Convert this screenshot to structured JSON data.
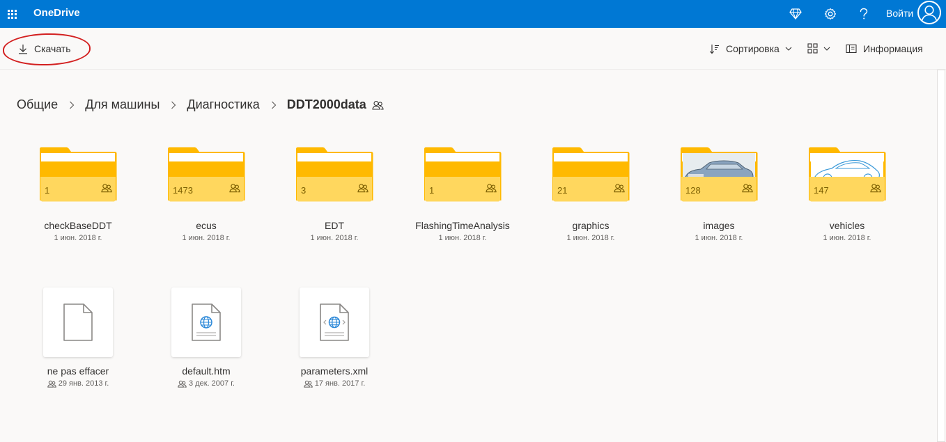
{
  "app": {
    "name": "OneDrive",
    "signin_label": "Войти"
  },
  "header_icons": [
    "premium-diamond-icon",
    "settings-gear-icon",
    "help-question-icon"
  ],
  "commands": {
    "download": "Скачать",
    "sort": "Сортировка",
    "info": "Информация"
  },
  "breadcrumb": {
    "items": [
      "Общие",
      "Для машины",
      "Диагностика"
    ],
    "current": "DDT2000data"
  },
  "folders": [
    {
      "name": "checkBaseDDT",
      "count": "1",
      "date": "1 июн. 2018 г.",
      "thumb": "none"
    },
    {
      "name": "ecus",
      "count": "1473",
      "date": "1 июн. 2018 г.",
      "thumb": "none"
    },
    {
      "name": "EDT",
      "count": "3",
      "date": "1 июн. 2018 г.",
      "thumb": "none"
    },
    {
      "name": "FlashingTimeAnalysis",
      "count": "1",
      "date": "1 июн. 2018 г.",
      "thumb": "none"
    },
    {
      "name": "graphics",
      "count": "21",
      "date": "1 июн. 2018 г.",
      "thumb": "none"
    },
    {
      "name": "images",
      "count": "128",
      "date": "1 июн. 2018 г.",
      "thumb": "car-photo"
    },
    {
      "name": "vehicles",
      "count": "147",
      "date": "1 июн. 2018 г.",
      "thumb": "car-sketch"
    }
  ],
  "files": [
    {
      "name": "ne pas effacer",
      "date": "29 янв. 2013 г.",
      "icon": "generic-file-icon"
    },
    {
      "name": "default.htm",
      "date": "3 дек. 2007 г.",
      "icon": "html-file-icon"
    },
    {
      "name": "parameters.xml",
      "date": "17 янв. 2017 г.",
      "icon": "xml-file-icon"
    }
  ],
  "colors": {
    "brand": "#0078d4",
    "folder_back": "#ffb900",
    "folder_front": "#ffd75e",
    "annotation": "#d32020"
  }
}
